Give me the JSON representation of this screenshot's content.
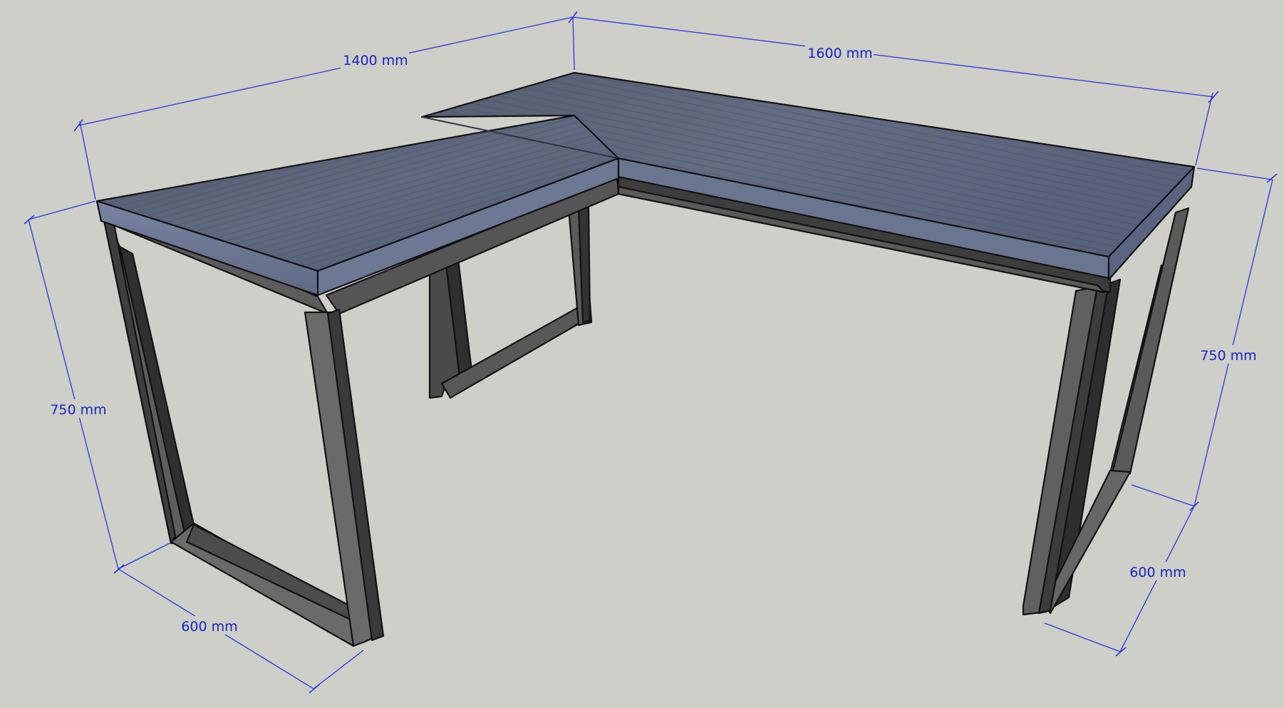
{
  "dimensions": {
    "left_top_length": "1400 mm",
    "right_top_length": "1600 mm",
    "left_height": "750 mm",
    "right_height": "750 mm",
    "left_depth": "600 mm",
    "right_depth": "600 mm"
  },
  "colors": {
    "background": "#cdcfc8",
    "tabletop": "#5b6478",
    "tabletop_edge": "#6e7b96",
    "frame_light": "#5c5c5c",
    "frame_dark": "#3a3a3a",
    "dimension": "#1a22c8"
  }
}
